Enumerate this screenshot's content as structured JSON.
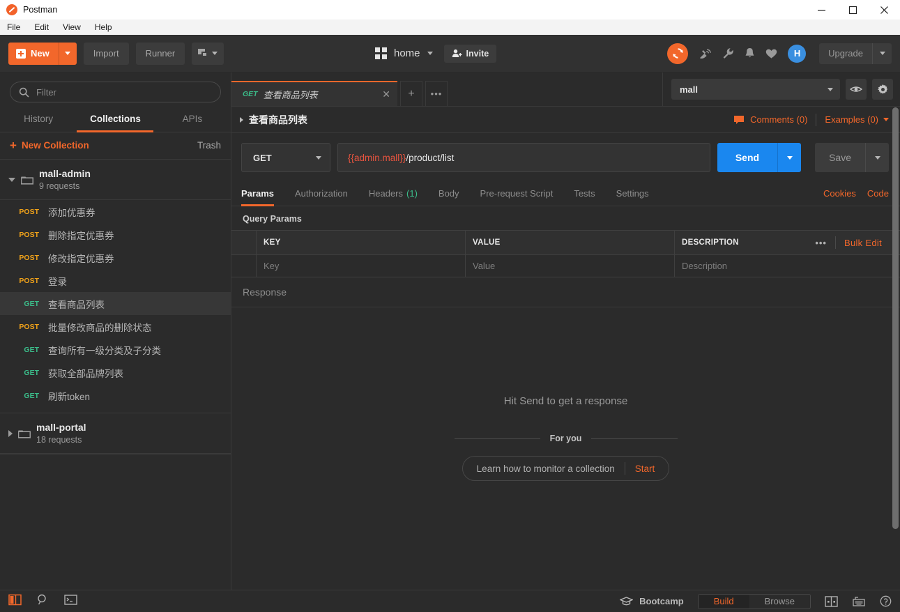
{
  "window": {
    "title": "Postman",
    "minimize": "minimize-icon",
    "maximize": "maximize-icon",
    "close": "close-icon"
  },
  "menubar": {
    "items": [
      "File",
      "Edit",
      "View",
      "Help"
    ]
  },
  "toolbar": {
    "new_label": "New",
    "import_label": "Import",
    "runner_label": "Runner",
    "new_window_icon": "new-window-icon",
    "workspace_label": "home",
    "invite_label": "Invite",
    "sync_icon": "sync-icon",
    "satellite_icon": "satellite-dish-icon",
    "wrench_icon": "wrench-icon",
    "bell_icon": "bell-icon",
    "heart_icon": "heart-icon",
    "avatar_label": "H",
    "upgrade_label": "Upgrade"
  },
  "sidebar": {
    "filter_placeholder": "Filter",
    "tabs": [
      {
        "label": "History",
        "active": false
      },
      {
        "label": "Collections",
        "active": true
      },
      {
        "label": "APIs",
        "active": false
      }
    ],
    "new_collection_label": "New Collection",
    "trash_label": "Trash",
    "collections": [
      {
        "name": "mall-admin",
        "requests_count": "9 requests",
        "expanded": true,
        "requests": [
          {
            "method": "POST",
            "name": "添加优惠券",
            "selected": false
          },
          {
            "method": "POST",
            "name": "删除指定优惠券",
            "selected": false
          },
          {
            "method": "POST",
            "name": "修改指定优惠券",
            "selected": false
          },
          {
            "method": "POST",
            "name": "登录",
            "selected": false
          },
          {
            "method": "GET",
            "name": "查看商品列表",
            "selected": true
          },
          {
            "method": "POST",
            "name": "批量修改商品的删除状态",
            "selected": false
          },
          {
            "method": "GET",
            "name": "查询所有一级分类及子分类",
            "selected": false
          },
          {
            "method": "GET",
            "name": "获取全部品牌列表",
            "selected": false
          },
          {
            "method": "GET",
            "name": "刷新token",
            "selected": false
          }
        ]
      },
      {
        "name": "mall-portal",
        "requests_count": "18 requests",
        "expanded": false,
        "requests": []
      }
    ]
  },
  "main": {
    "open_tab": {
      "method": "GET",
      "name": "查看商品列表",
      "close_icon": "close-icon"
    },
    "add_tab_icon": "plus-icon",
    "tab_more_icon": "ellipsis-icon",
    "environment": {
      "selected": "mall",
      "eye_icon": "eye-icon",
      "gear_icon": "gear-icon"
    },
    "request_title": "查看商品列表",
    "comments_label": "Comments (0)",
    "examples_label": "Examples (0)",
    "method": "GET",
    "url_variable": "{{admin.mall}}",
    "url_path": "/product/list",
    "send_label": "Send",
    "save_label": "Save",
    "request_tabs": [
      {
        "label": "Params",
        "count": "",
        "active": true
      },
      {
        "label": "Authorization",
        "count": "",
        "active": false
      },
      {
        "label": "Headers",
        "count": "(1)",
        "active": false
      },
      {
        "label": "Body",
        "count": "",
        "active": false
      },
      {
        "label": "Pre-request Script",
        "count": "",
        "active": false
      },
      {
        "label": "Tests",
        "count": "",
        "active": false
      },
      {
        "label": "Settings",
        "count": "",
        "active": false
      }
    ],
    "cookies_label": "Cookies",
    "code_label": "Code",
    "query_params_label": "Query Params",
    "params_table": {
      "headers": [
        "KEY",
        "VALUE",
        "DESCRIPTION"
      ],
      "more_icon": "ellipsis-icon",
      "bulk_edit_label": "Bulk Edit",
      "empty_row": [
        "Key",
        "Value",
        "Description"
      ]
    },
    "response_label": "Response",
    "empty_response_text": "Hit Send to get a response",
    "for_you_label": "For you",
    "learn_text": "Learn how to monitor a collection",
    "start_label": "Start"
  },
  "statusbar": {
    "sidebar_toggle_icon": "sidebar-toggle-icon",
    "find_icon": "search-icon",
    "console_icon": "console-icon",
    "bootcamp_label": "Bootcamp",
    "build_label": "Build",
    "browse_label": "Browse",
    "two_pane_icon": "two-pane-icon",
    "keyboard_icon": "keyboard-icon",
    "help_icon": "help-icon"
  },
  "colors": {
    "accent": "#f2672b",
    "send": "#1a87ef",
    "get": "#3bbd8a",
    "post": "#f0a21a",
    "variable_unresolved": "#e8543f",
    "background": "#2b2b2b"
  }
}
